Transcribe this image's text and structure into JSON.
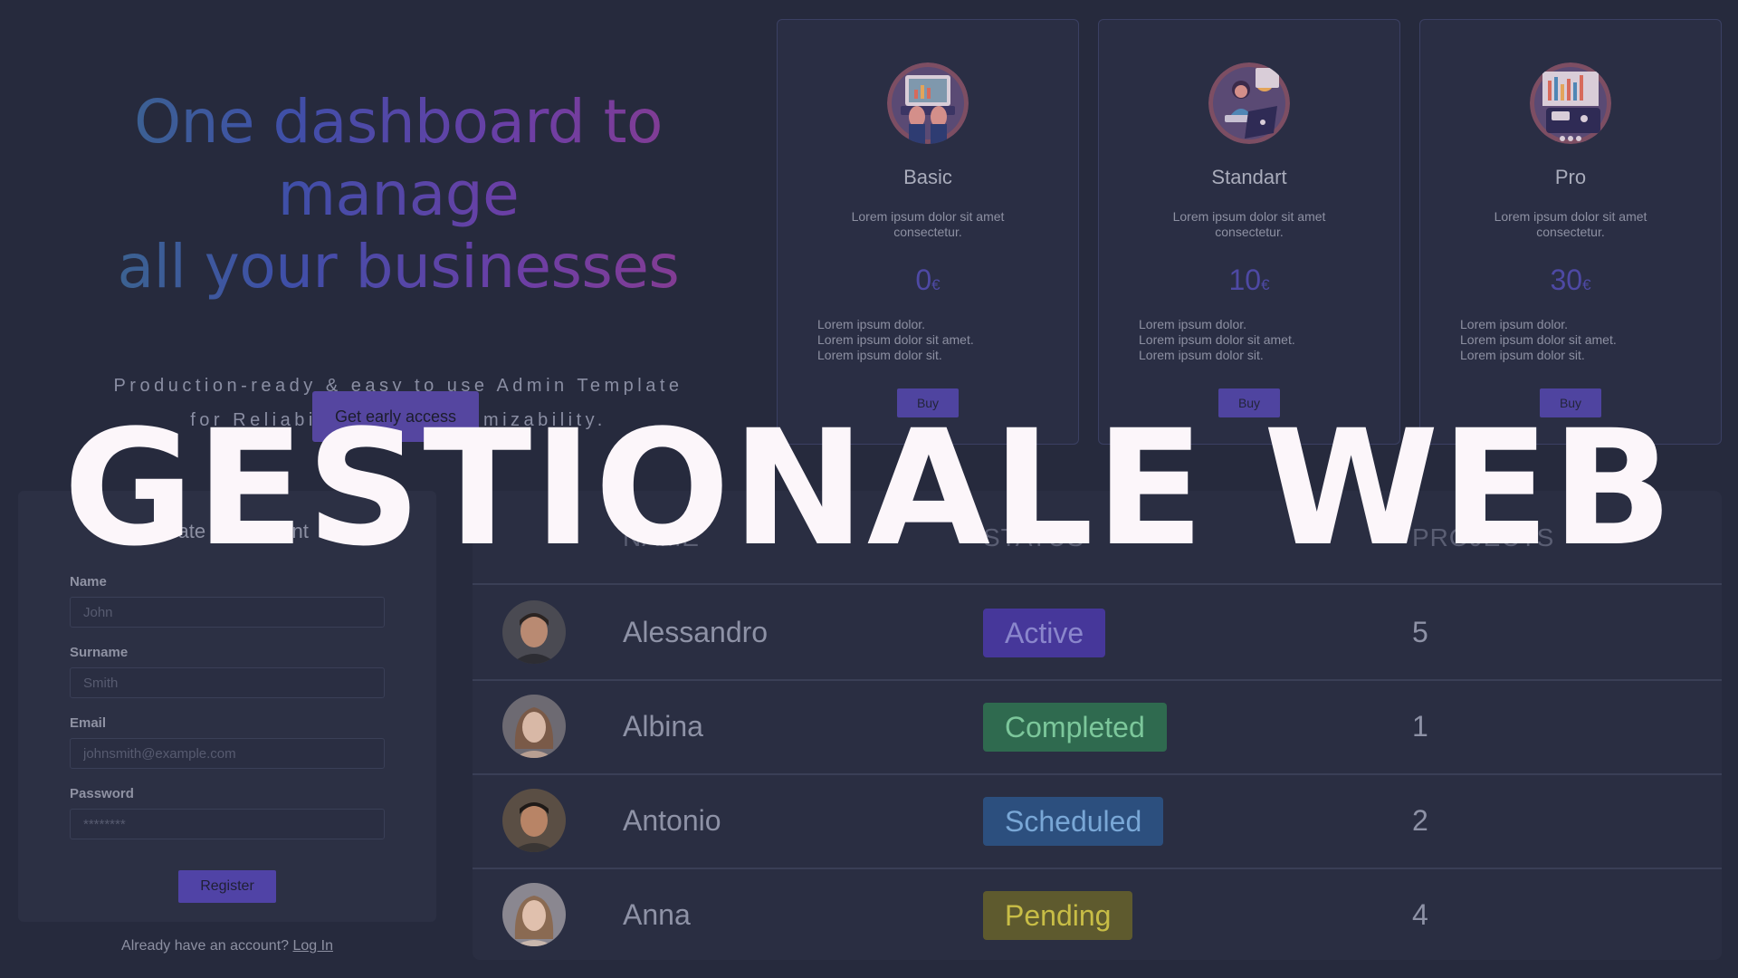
{
  "hero": {
    "title_line1": "One dashboard to manage",
    "title_line2": "all your businesses",
    "subtitle_line1": "Production-ready & easy to use Admin Template",
    "subtitle_line2": "for Reliability and Customizability.",
    "cta_label": "Get early access"
  },
  "plans": [
    {
      "icon": "laptop-typing-illustration-icon",
      "name": "Basic",
      "description": "Lorem ipsum dolor sit amet consectetur.",
      "price": "0",
      "currency": "€",
      "features": [
        "Lorem ipsum dolor.",
        "Lorem ipsum dolor sit amet.",
        "Lorem ipsum dolor sit."
      ],
      "button": "Buy"
    },
    {
      "icon": "woman-with-laptop-illustration-icon",
      "name": "Standart",
      "description": "Lorem ipsum dolor sit amet consectetur.",
      "price": "10",
      "currency": "€",
      "features": [
        "Lorem ipsum dolor.",
        "Lorem ipsum dolor sit amet.",
        "Lorem ipsum dolor sit."
      ],
      "button": "Buy"
    },
    {
      "icon": "analytics-board-illustration-icon",
      "name": "Pro",
      "description": "Lorem ipsum dolor sit amet consectetur.",
      "price": "30",
      "currency": "€",
      "features": [
        "Lorem ipsum dolor.",
        "Lorem ipsum dolor sit amet.",
        "Lorem ipsum dolor sit."
      ],
      "button": "Buy"
    }
  ],
  "register_form": {
    "title": "Create an account",
    "fields": [
      {
        "label": "Name",
        "placeholder": "John"
      },
      {
        "label": "Surname",
        "placeholder": "Smith"
      },
      {
        "label": "Email",
        "placeholder": "johnsmith@example.com"
      },
      {
        "label": "Password",
        "placeholder": "********"
      }
    ],
    "submit": "Register",
    "login_prompt": "Already have an account?",
    "login_link": "Log In"
  },
  "team_table": {
    "columns": [
      "NAME",
      "STATUS",
      "PROJECTS"
    ],
    "rows": [
      {
        "name": "Alessandro",
        "status": "Active",
        "status_color": "#46379a",
        "status_text_color": "#8a86cc",
        "projects": "5",
        "avatar": "man-avatar-icon"
      },
      {
        "name": "Albina",
        "status": "Completed",
        "status_color": "#2f6a4f",
        "status_text_color": "#7cc79b",
        "projects": "1",
        "avatar": "woman-avatar-icon"
      },
      {
        "name": "Antonio",
        "status": "Scheduled",
        "status_color": "#2c4f7e",
        "status_text_color": "#79a7d6",
        "projects": "2",
        "avatar": "man-avatar-icon"
      },
      {
        "name": "Anna",
        "status": "Pending",
        "status_color": "#5e5a2e",
        "status_text_color": "#c8bd46",
        "projects": "4",
        "avatar": "woman-avatar-icon"
      }
    ]
  },
  "overlay_title": "GESTIONALE WEB",
  "colors": {
    "background": "#262a3d",
    "accent": "#5043a6",
    "gradient": [
      "#3a6b86",
      "#3f4fa8",
      "#6a3fa6",
      "#8e3b8b"
    ]
  }
}
